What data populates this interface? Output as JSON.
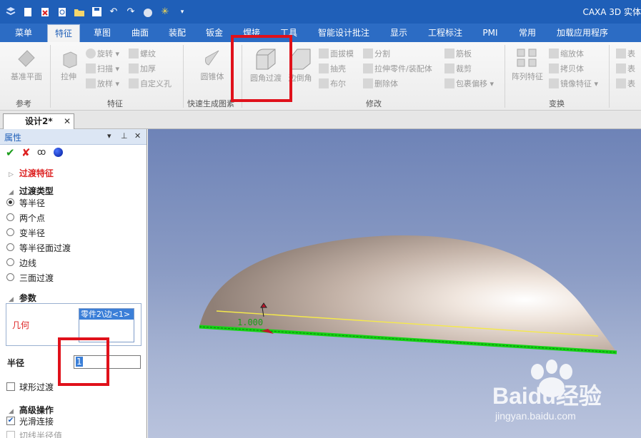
{
  "app": {
    "title": "CAXA 3D 实体"
  },
  "menu": {
    "tabs": [
      "菜单",
      "特征",
      "草图",
      "曲面",
      "装配",
      "钣金",
      "焊接",
      "工具",
      "智能设计批注",
      "显示",
      "工程标注",
      "PMI",
      "常用",
      "加载应用程序"
    ],
    "active": "特征"
  },
  "ribbon": {
    "groups": {
      "reference": {
        "label": "参考",
        "datum_plane": "基准平面"
      },
      "feature": {
        "label": "特征",
        "extrude": "拉伸",
        "revolve": "旋转",
        "sweep": "扫描",
        "loft": "放样",
        "thread": "螺纹",
        "thicken": "加厚",
        "custom_hole": "自定义孔"
      },
      "quick": {
        "label": "快速生成图素",
        "cone": "圆锥体"
      },
      "modify": {
        "label": "修改",
        "fillet": "圆角过渡",
        "chamfer": "边倒角",
        "draft": "面拔模",
        "shell": "抽壳",
        "boolean": "布尔",
        "split": "分割",
        "extrude_part": "拉伸零件/装配体",
        "delete_body": "删除体",
        "rib": "筋板",
        "trim": "裁剪",
        "wrap_offset": "包裹偏移"
      },
      "transform": {
        "label": "变换",
        "pattern": "阵列特征",
        "scale": "缩放体",
        "copy_body": "拷贝体",
        "mirror": "镜像特征"
      },
      "extra": {
        "surface1": "表",
        "surface2": "表",
        "surface3": "表"
      }
    }
  },
  "document": {
    "tab": "设计2*"
  },
  "properties": {
    "title": "属性",
    "feature_title": "过渡特征",
    "type_section": "过渡类型",
    "types": [
      "等半径",
      "两个点",
      "变半径",
      "等半径面过渡",
      "边线",
      "三面过渡"
    ],
    "selected_type_index": 0,
    "params_section": "参数",
    "geometry_label": "几何",
    "geometry_value": "零件2\\边<1>",
    "radius_label": "半径",
    "radius_value": "1",
    "spherical_label": "球形过渡",
    "spherical_checked": false,
    "advanced_section": "高级操作",
    "smooth_label": "光滑连接",
    "smooth_checked": true,
    "tangent_label": "切线半径值"
  },
  "viewport": {
    "dimension": "1.000"
  },
  "watermark": {
    "brand": "Baidu经验",
    "url": "jingyan.baidu.com"
  },
  "colors": {
    "title_bar": "#1f5fb8",
    "highlight": "#e0111b",
    "edge_highlight": "#14d414",
    "dimension_text": "#1a9c1a"
  }
}
